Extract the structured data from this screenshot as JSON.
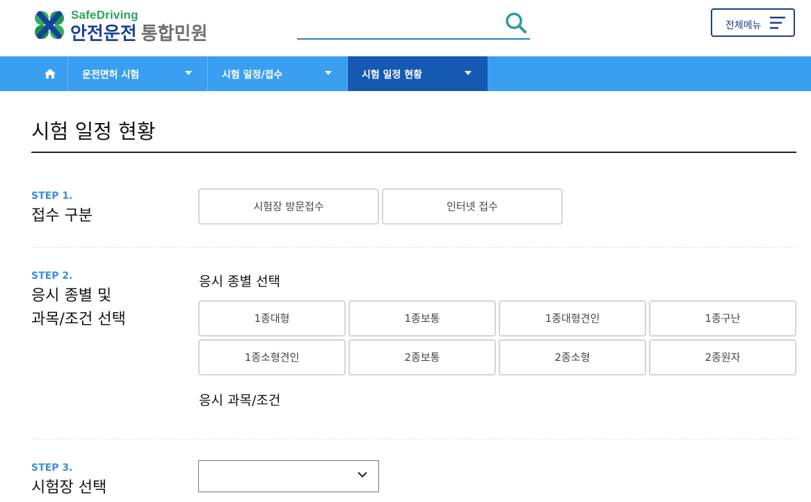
{
  "header": {
    "logo_en": "SafeDriving",
    "logo_ko_main": "안전운전",
    "logo_ko_sub": "통합민원",
    "search": {
      "value": "",
      "placeholder": ""
    },
    "menu_label": "전체메뉴"
  },
  "nav": {
    "items": [
      {
        "label": "운전면허 시험",
        "active": false
      },
      {
        "label": "시험 일정/접수",
        "active": false
      },
      {
        "label": "시험 일정 현황",
        "active": true
      }
    ]
  },
  "page": {
    "title": "시험 일정 현황"
  },
  "step1": {
    "num": "STEP 1.",
    "title": "접수 구분",
    "options": [
      "시험장 방문접수",
      "인터넷 접수"
    ]
  },
  "step2": {
    "num": "STEP 2.",
    "title_line1": "응시 종별 및",
    "title_line2": "과목/조건 선택",
    "license_label": "응시 종별 선택",
    "license_options": [
      "1종대형",
      "1종보통",
      "1종대형견인",
      "1종구난",
      "1종소형견인",
      "2종보통",
      "2종소형",
      "2종원자"
    ],
    "condition_label": "응시 과목/조건"
  },
  "step3": {
    "num": "STEP 3.",
    "title": "시험장 선택",
    "select_value": ""
  },
  "colors": {
    "nav_bg": "#3a9ff0",
    "nav_active": "#1559b3",
    "brand_blue": "#18429a",
    "brand_green": "#26a55a",
    "step_blue": "#3a8fd8"
  },
  "icons": [
    "clover-logo-icon",
    "search-icon",
    "hamburger-icon",
    "home-icon",
    "caret-down-icon",
    "chevron-down-icon"
  ]
}
